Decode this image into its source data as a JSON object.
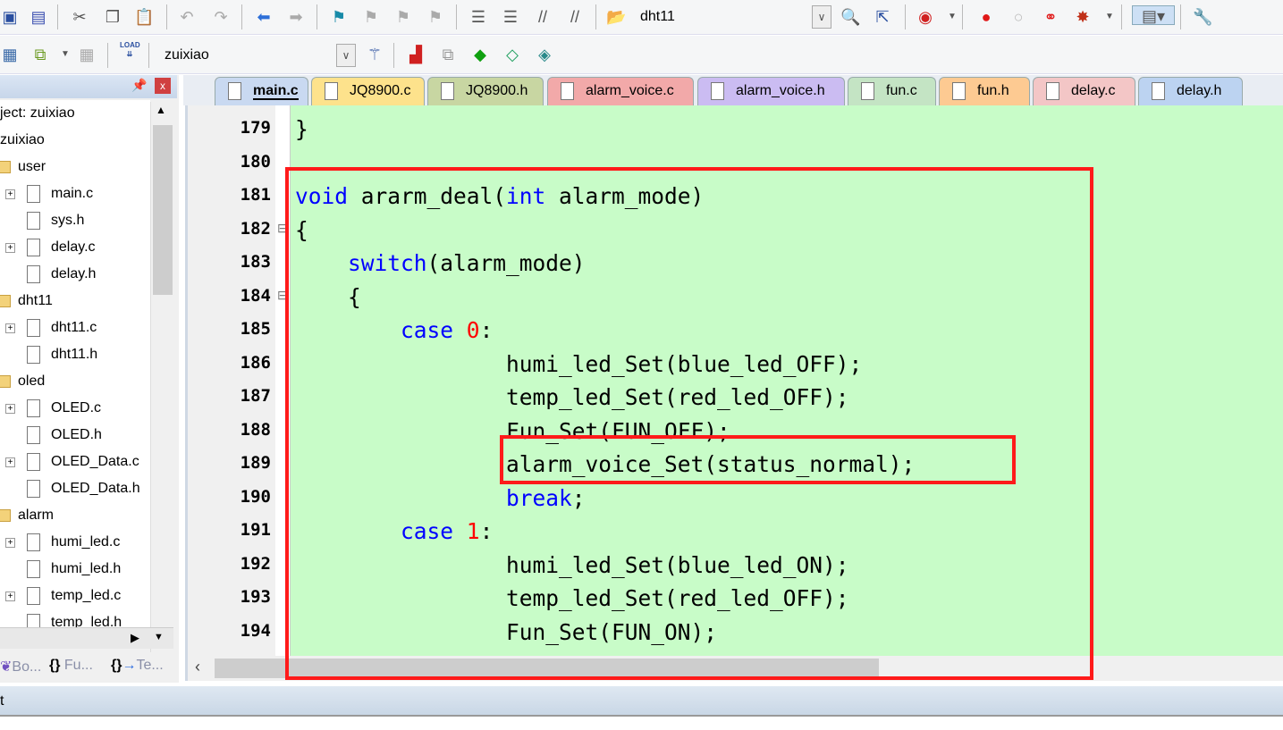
{
  "toolbar1": {
    "target_combo": "dht11"
  },
  "toolbar2": {
    "project_combo": "zuixiao",
    "load_label": "LOAD"
  },
  "project_panel": {
    "items": [
      {
        "label": "ject: zuixiao",
        "type": "root",
        "level": 0
      },
      {
        "label": "zuixiao",
        "type": "target",
        "level": 0
      },
      {
        "label": "user",
        "type": "folder",
        "level": 0
      },
      {
        "label": "main.c",
        "type": "file",
        "expand": true
      },
      {
        "label": "sys.h",
        "type": "file",
        "expand": false
      },
      {
        "label": "delay.c",
        "type": "file",
        "expand": true
      },
      {
        "label": "delay.h",
        "type": "file",
        "expand": false
      },
      {
        "label": "dht11",
        "type": "folder"
      },
      {
        "label": "dht11.c",
        "type": "file",
        "expand": true
      },
      {
        "label": "dht11.h",
        "type": "file",
        "expand": false
      },
      {
        "label": "oled",
        "type": "folder"
      },
      {
        "label": "OLED.c",
        "type": "file",
        "expand": true
      },
      {
        "label": "OLED.h",
        "type": "file",
        "expand": false
      },
      {
        "label": "OLED_Data.c",
        "type": "file",
        "expand": true
      },
      {
        "label": "OLED_Data.h",
        "type": "file",
        "expand": false
      },
      {
        "label": "alarm",
        "type": "folder"
      },
      {
        "label": "humi_led.c",
        "type": "file",
        "expand": true
      },
      {
        "label": "humi_led.h",
        "type": "file",
        "expand": false
      },
      {
        "label": "temp_led.c",
        "type": "file",
        "expand": true
      },
      {
        "label": "temp_led.h",
        "type": "file",
        "expand": false
      }
    ],
    "bottom_tabs": [
      "Bo...",
      "Fu...",
      "Te..."
    ]
  },
  "tabs": [
    {
      "label": "main.c",
      "color": "#c9d9f1",
      "active": true
    },
    {
      "label": "JQ8900.c",
      "color": "#fde28c"
    },
    {
      "label": "JQ8900.h",
      "color": "#c8d6a2"
    },
    {
      "label": "alarm_voice.c",
      "color": "#f2a9a9"
    },
    {
      "label": "alarm_voice.h",
      "color": "#cbbcf2"
    },
    {
      "label": "fun.c",
      "color": "#c4e4c4"
    },
    {
      "label": "fun.h",
      "color": "#fdca92"
    },
    {
      "label": "delay.c",
      "color": "#f3c6c6"
    },
    {
      "label": "delay.h",
      "color": "#bcd3f1"
    }
  ],
  "editor": {
    "background": "#c8fcc8",
    "lines": [
      {
        "n": "179",
        "fold": "",
        "tokens": [
          [
            "",
            "}"
          ]
        ]
      },
      {
        "n": "180",
        "fold": "",
        "tokens": []
      },
      {
        "n": "181",
        "fold": "",
        "tokens": [
          [
            "kw",
            "void"
          ],
          [
            "",
            " ararm_deal("
          ],
          [
            "kw",
            "int"
          ],
          [
            "",
            " alarm_mode)"
          ]
        ]
      },
      {
        "n": "182",
        "fold": "⊟",
        "tokens": [
          [
            "",
            "{"
          ]
        ]
      },
      {
        "n": "183",
        "fold": "",
        "tokens": [
          [
            "",
            "    "
          ],
          [
            "kw",
            "switch"
          ],
          [
            "",
            "(alarm_mode)"
          ]
        ]
      },
      {
        "n": "184",
        "fold": "⊟",
        "tokens": [
          [
            "",
            "    {"
          ]
        ]
      },
      {
        "n": "185",
        "fold": "",
        "tokens": [
          [
            "",
            "        "
          ],
          [
            "kw",
            "case"
          ],
          [
            "",
            " "
          ],
          [
            "num",
            "0"
          ],
          [
            "",
            ":"
          ]
        ]
      },
      {
        "n": "186",
        "fold": "",
        "tokens": [
          [
            "",
            "                humi_led_Set(blue_led_OFF);"
          ]
        ]
      },
      {
        "n": "187",
        "fold": "",
        "tokens": [
          [
            "",
            "                temp_led_Set(red_led_OFF);"
          ]
        ]
      },
      {
        "n": "188",
        "fold": "",
        "tokens": [
          [
            "",
            "                Fun_Set(FUN_OFF);"
          ]
        ]
      },
      {
        "n": "189",
        "fold": "",
        "tokens": [
          [
            "",
            "                alarm_voice_Set(status_normal);"
          ]
        ]
      },
      {
        "n": "190",
        "fold": "",
        "tokens": [
          [
            "",
            "                "
          ],
          [
            "kw",
            "break"
          ],
          [
            "",
            ";"
          ]
        ]
      },
      {
        "n": "191",
        "fold": "",
        "tokens": [
          [
            "",
            "        "
          ],
          [
            "kw",
            "case"
          ],
          [
            "",
            " "
          ],
          [
            "num",
            "1"
          ],
          [
            "",
            ":"
          ]
        ]
      },
      {
        "n": "192",
        "fold": "",
        "tokens": [
          [
            "",
            "                humi_led_Set(blue_led_ON);"
          ]
        ]
      },
      {
        "n": "193",
        "fold": "",
        "tokens": [
          [
            "",
            "                temp_led_Set(red_led_OFF);"
          ]
        ]
      },
      {
        "n": "194",
        "fold": "",
        "tokens": [
          [
            "",
            "                Fun_Set(FUN_ON);"
          ]
        ]
      }
    ]
  },
  "status": {
    "text": "t"
  }
}
